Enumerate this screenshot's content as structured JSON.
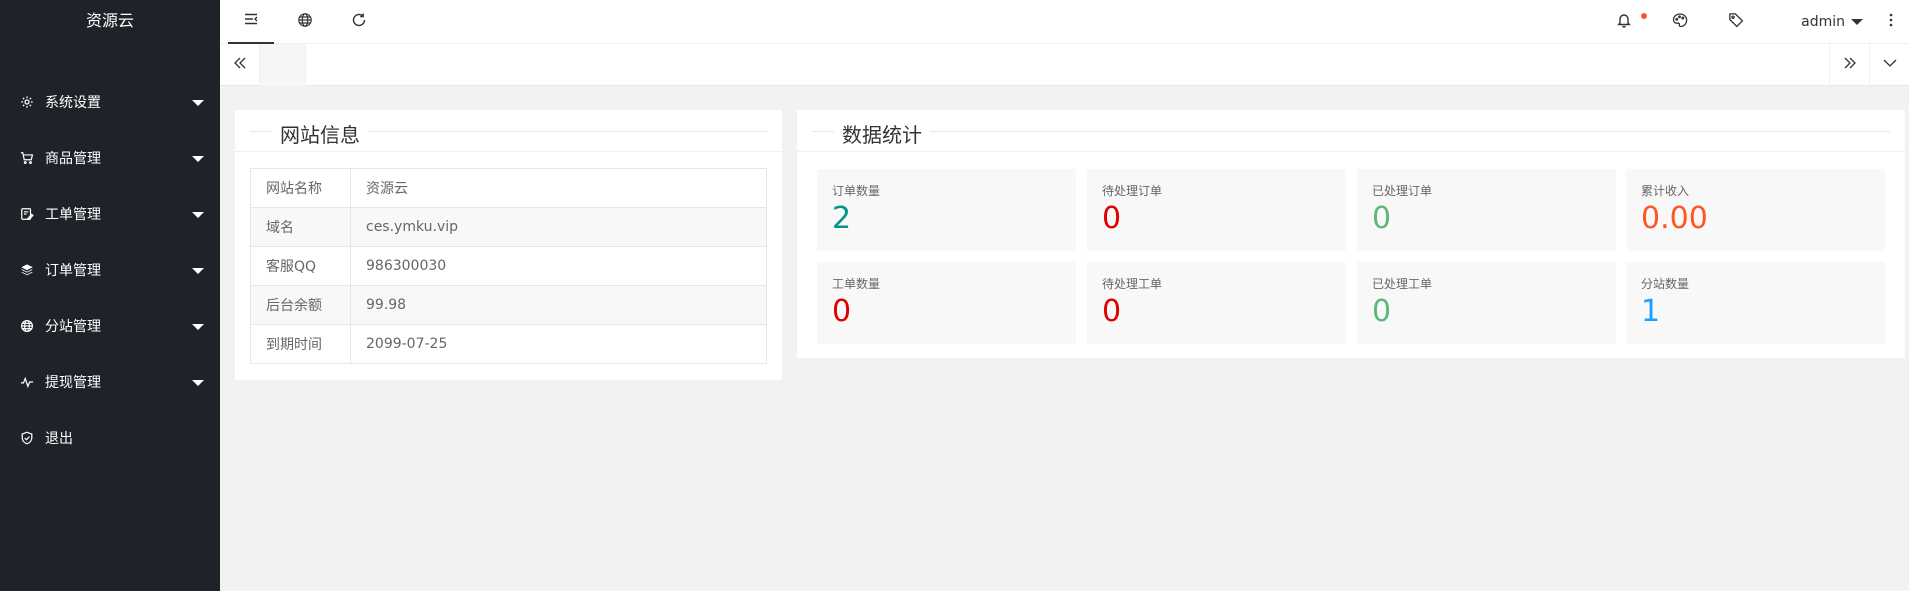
{
  "app": {
    "title": "资源云"
  },
  "sidebar": {
    "items": [
      {
        "label": "系统设置",
        "icon": "gear-icon",
        "has_caret": true
      },
      {
        "label": "商品管理",
        "icon": "cart-icon",
        "has_caret": true
      },
      {
        "label": "工单管理",
        "icon": "ticket-icon",
        "has_caret": true
      },
      {
        "label": "订单管理",
        "icon": "layers-icon",
        "has_caret": true
      },
      {
        "label": "分站管理",
        "icon": "globe-icon",
        "has_caret": true
      },
      {
        "label": "提现管理",
        "icon": "pulse-icon",
        "has_caret": true
      },
      {
        "label": "退出",
        "icon": "shield-icon",
        "has_caret": false
      }
    ]
  },
  "header": {
    "left_icons": [
      "menu-fold-icon",
      "globe-icon",
      "refresh-icon"
    ],
    "right_icons": [
      "bell-icon",
      "palette-icon",
      "tag-icon",
      "more-vertical-icon"
    ],
    "user": "admin",
    "notification_dot": true
  },
  "tabs": {
    "icons": [
      "chevrons-left-icon",
      "home-icon",
      "chevrons-right-icon",
      "chevron-down-icon"
    ]
  },
  "site_info": {
    "title": "网站信息",
    "rows": [
      {
        "key": "网站名称",
        "value": "资源云"
      },
      {
        "key": "域名",
        "value": "ces.ymku.vip"
      },
      {
        "key": "客服QQ",
        "value": "986300030"
      },
      {
        "key": "后台余额",
        "value": "99.98"
      },
      {
        "key": "到期时间",
        "value": "2099-07-25"
      }
    ]
  },
  "stats": {
    "title": "数据统计",
    "items": [
      {
        "label": "订单数量",
        "value": "2",
        "color": "#009688"
      },
      {
        "label": "待处理订单",
        "value": "0",
        "color": "#e00000"
      },
      {
        "label": "已处理订单",
        "value": "0",
        "color": "#5fb878"
      },
      {
        "label": "累计收入",
        "value": "0.00",
        "color": "#ff5722"
      },
      {
        "label": "工单数量",
        "value": "0",
        "color": "#e00000"
      },
      {
        "label": "待处理工单",
        "value": "0",
        "color": "#e00000"
      },
      {
        "label": "已处理工单",
        "value": "0",
        "color": "#5fb878"
      },
      {
        "label": "分站数量",
        "value": "1",
        "color": "#1e9fff"
      }
    ]
  }
}
